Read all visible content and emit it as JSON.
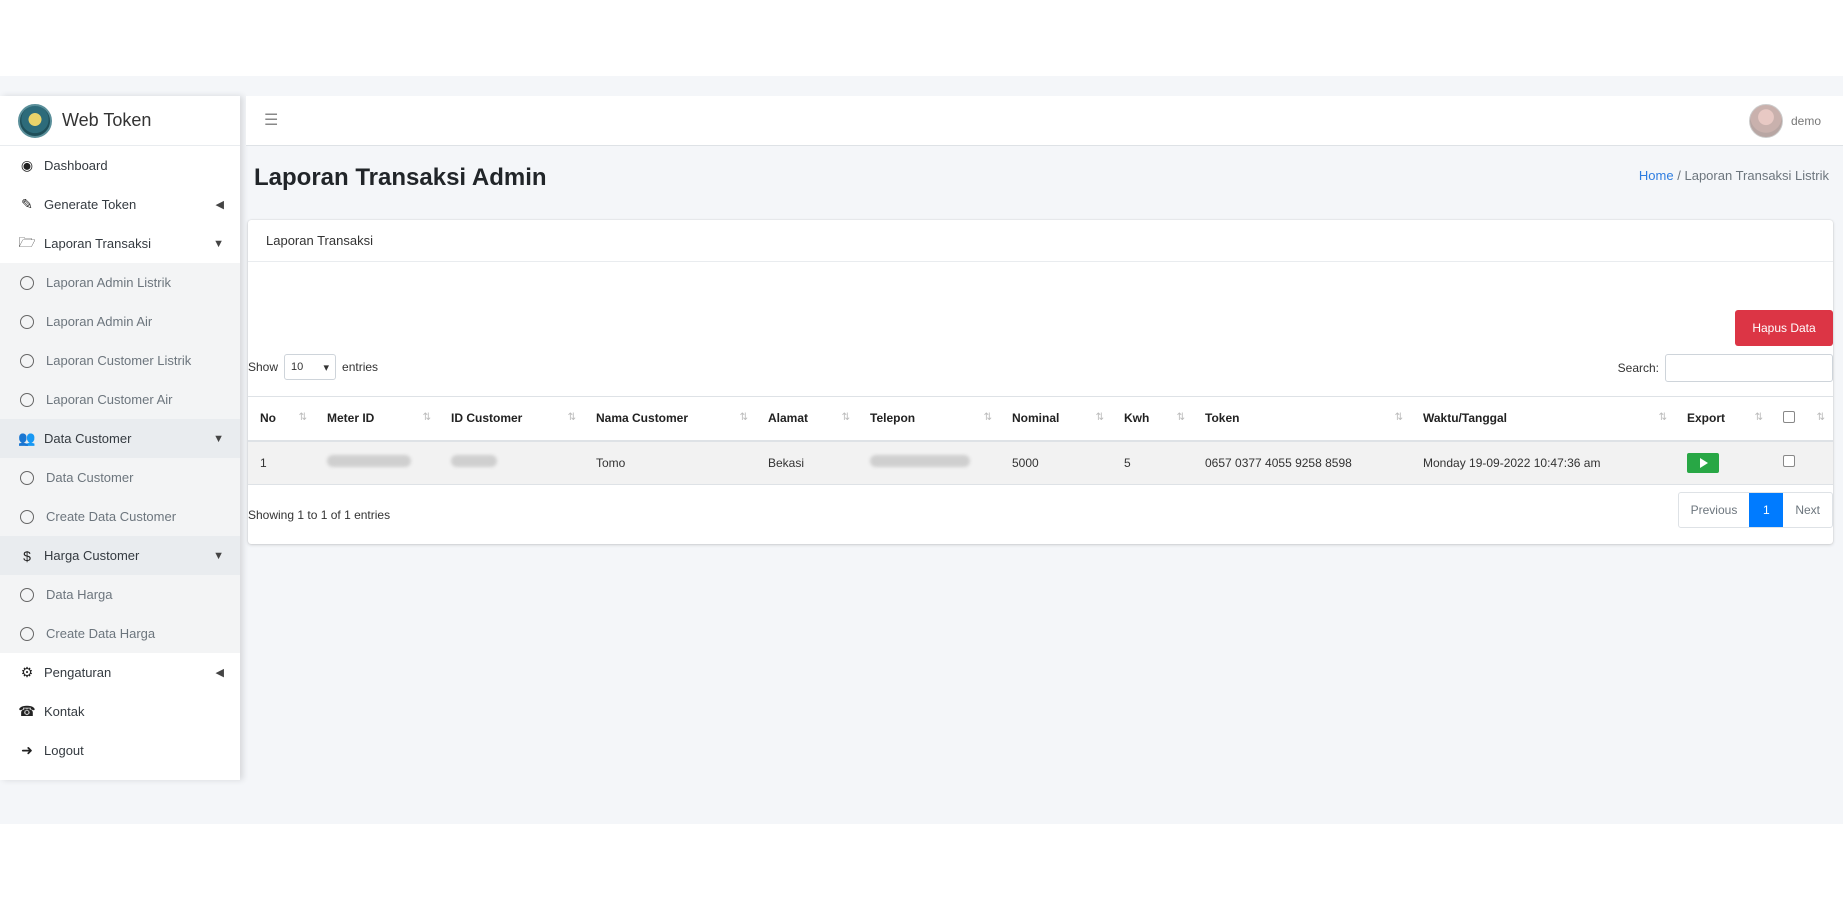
{
  "brand": {
    "name": "Web Token"
  },
  "topbar": {
    "menu_icon": "hamburger-icon",
    "user_name": "demo"
  },
  "sidebar": {
    "items": [
      {
        "label": "Dashboard",
        "icon": "tachometer-icon"
      },
      {
        "label": "Generate Token",
        "icon": "edit-icon"
      },
      {
        "label": "Laporan Transaksi",
        "icon": "folder-open-icon"
      },
      {
        "label": "Laporan Admin Listrik"
      },
      {
        "label": "Laporan Admin Air"
      },
      {
        "label": "Laporan Customer Listrik"
      },
      {
        "label": "Laporan Customer Air"
      },
      {
        "label": "Data Customer",
        "icon": "users-icon"
      },
      {
        "label": "Data Customer"
      },
      {
        "label": "Create Data Customer"
      },
      {
        "label": "Harga Customer",
        "icon": "dollar-icon"
      },
      {
        "label": "Data Harga"
      },
      {
        "label": "Create Data Harga"
      },
      {
        "label": "Pengaturan",
        "icon": "cogs-icon"
      },
      {
        "label": "Kontak",
        "icon": "phone-icon"
      },
      {
        "label": "Logout",
        "icon": "sign-out-icon"
      }
    ]
  },
  "page": {
    "title": "Laporan Transaksi Admin",
    "breadcrumb_home": "Home",
    "breadcrumb_sep": "/",
    "breadcrumb_current": "Laporan Transaksi Listrik"
  },
  "card": {
    "header": "Laporan Transaksi",
    "delete_label": "Hapus Data",
    "show_label": "Show",
    "entries_label": "entries",
    "page_size": "10",
    "search_label": "Search:",
    "info": "Showing 1 to 1 of 1 entries",
    "prev_label": "Previous",
    "current_page": "1",
    "next_label": "Next"
  },
  "table": {
    "columns": [
      "No",
      "Meter ID",
      "ID Customer",
      "Nama Customer",
      "Alamat",
      "Telepon",
      "Nominal",
      "Kwh",
      "Token",
      "Waktu/Tanggal",
      "Export",
      ""
    ],
    "rows": [
      {
        "no": "1",
        "nama": "Tomo",
        "alamat": "Bekasi",
        "nominal": "5000",
        "kwh": "5",
        "token": "0657 0377 4055 9258 8598",
        "waktu": "Monday 19-09-2022 10:47:36 am"
      }
    ]
  }
}
